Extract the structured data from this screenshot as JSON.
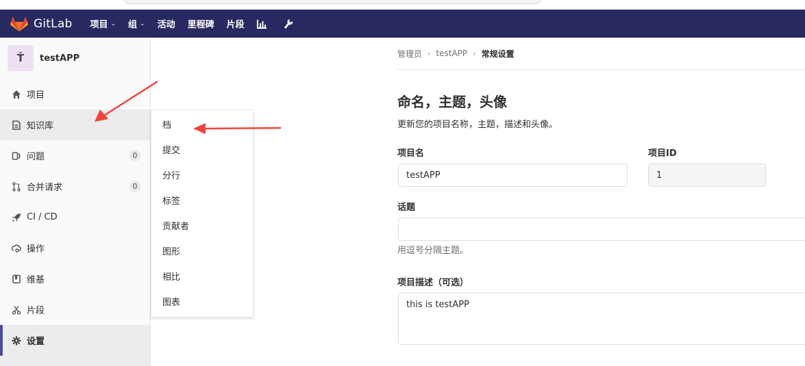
{
  "navbar": {
    "brand": "GitLab",
    "items": [
      {
        "label": "项目",
        "caret": "⌄"
      },
      {
        "label": "组",
        "caret": "⌄"
      },
      {
        "label": "活动"
      },
      {
        "label": "里程碑"
      },
      {
        "label": "片段"
      }
    ],
    "icons": [
      "chart-icon",
      "wrench-icon"
    ]
  },
  "sidebar": {
    "avatar_letter": "Ť",
    "project_name": "testAPP",
    "items": [
      {
        "label": "项目",
        "icon": "home-icon"
      },
      {
        "label": "知识库",
        "icon": "document-icon"
      },
      {
        "label": "问题",
        "icon": "issues-icon",
        "count": "0"
      },
      {
        "label": "合并请求",
        "icon": "merge-request-icon",
        "count": "0"
      },
      {
        "label": "CI / CD",
        "icon": "rocket-icon"
      },
      {
        "label": "操作",
        "icon": "cloud-gear-icon"
      },
      {
        "label": "维基",
        "icon": "book-icon"
      },
      {
        "label": "片段",
        "icon": "scissors-icon"
      },
      {
        "label": "设置",
        "icon": "settings-icon"
      }
    ]
  },
  "flyout": {
    "items": [
      "档",
      "提交",
      "分行",
      "标签",
      "贡献者",
      "图形",
      "相比",
      "图表"
    ]
  },
  "breadcrumb": {
    "items": [
      "管理员",
      "testAPP"
    ],
    "current": "常规设置"
  },
  "form": {
    "section_title": "命名，主题，头像",
    "section_desc": "更新您的项目名称，主题，描述和头像。",
    "project_name_label": "项目名",
    "project_name_value": "testAPP",
    "project_id_label": "项目ID",
    "project_id_value": "1",
    "topics_label": "话题",
    "topics_value": "",
    "topics_help": "用逗号分隔主题。",
    "description_label": "项目描述（可选）",
    "description_value": "this is testAPP"
  },
  "colors": {
    "navbar": "#292961",
    "accent": "#4b4ba3",
    "annotation_arrow": "#f0443a"
  }
}
